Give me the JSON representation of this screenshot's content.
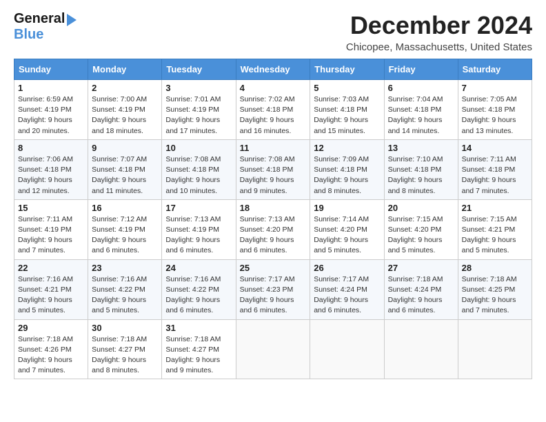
{
  "logo": {
    "line1": "General",
    "line2": "Blue"
  },
  "title": {
    "month_year": "December 2024",
    "location": "Chicopee, Massachusetts, United States"
  },
  "days_of_week": [
    "Sunday",
    "Monday",
    "Tuesday",
    "Wednesday",
    "Thursday",
    "Friday",
    "Saturday"
  ],
  "weeks": [
    [
      {
        "day": "1",
        "sunrise": "Sunrise: 6:59 AM",
        "sunset": "Sunset: 4:19 PM",
        "daylight": "Daylight: 9 hours and 20 minutes."
      },
      {
        "day": "2",
        "sunrise": "Sunrise: 7:00 AM",
        "sunset": "Sunset: 4:19 PM",
        "daylight": "Daylight: 9 hours and 18 minutes."
      },
      {
        "day": "3",
        "sunrise": "Sunrise: 7:01 AM",
        "sunset": "Sunset: 4:19 PM",
        "daylight": "Daylight: 9 hours and 17 minutes."
      },
      {
        "day": "4",
        "sunrise": "Sunrise: 7:02 AM",
        "sunset": "Sunset: 4:18 PM",
        "daylight": "Daylight: 9 hours and 16 minutes."
      },
      {
        "day": "5",
        "sunrise": "Sunrise: 7:03 AM",
        "sunset": "Sunset: 4:18 PM",
        "daylight": "Daylight: 9 hours and 15 minutes."
      },
      {
        "day": "6",
        "sunrise": "Sunrise: 7:04 AM",
        "sunset": "Sunset: 4:18 PM",
        "daylight": "Daylight: 9 hours and 14 minutes."
      },
      {
        "day": "7",
        "sunrise": "Sunrise: 7:05 AM",
        "sunset": "Sunset: 4:18 PM",
        "daylight": "Daylight: 9 hours and 13 minutes."
      }
    ],
    [
      {
        "day": "8",
        "sunrise": "Sunrise: 7:06 AM",
        "sunset": "Sunset: 4:18 PM",
        "daylight": "Daylight: 9 hours and 12 minutes."
      },
      {
        "day": "9",
        "sunrise": "Sunrise: 7:07 AM",
        "sunset": "Sunset: 4:18 PM",
        "daylight": "Daylight: 9 hours and 11 minutes."
      },
      {
        "day": "10",
        "sunrise": "Sunrise: 7:08 AM",
        "sunset": "Sunset: 4:18 PM",
        "daylight": "Daylight: 9 hours and 10 minutes."
      },
      {
        "day": "11",
        "sunrise": "Sunrise: 7:08 AM",
        "sunset": "Sunset: 4:18 PM",
        "daylight": "Daylight: 9 hours and 9 minutes."
      },
      {
        "day": "12",
        "sunrise": "Sunrise: 7:09 AM",
        "sunset": "Sunset: 4:18 PM",
        "daylight": "Daylight: 9 hours and 8 minutes."
      },
      {
        "day": "13",
        "sunrise": "Sunrise: 7:10 AM",
        "sunset": "Sunset: 4:18 PM",
        "daylight": "Daylight: 9 hours and 8 minutes."
      },
      {
        "day": "14",
        "sunrise": "Sunrise: 7:11 AM",
        "sunset": "Sunset: 4:18 PM",
        "daylight": "Daylight: 9 hours and 7 minutes."
      }
    ],
    [
      {
        "day": "15",
        "sunrise": "Sunrise: 7:11 AM",
        "sunset": "Sunset: 4:19 PM",
        "daylight": "Daylight: 9 hours and 7 minutes."
      },
      {
        "day": "16",
        "sunrise": "Sunrise: 7:12 AM",
        "sunset": "Sunset: 4:19 PM",
        "daylight": "Daylight: 9 hours and 6 minutes."
      },
      {
        "day": "17",
        "sunrise": "Sunrise: 7:13 AM",
        "sunset": "Sunset: 4:19 PM",
        "daylight": "Daylight: 9 hours and 6 minutes."
      },
      {
        "day": "18",
        "sunrise": "Sunrise: 7:13 AM",
        "sunset": "Sunset: 4:20 PM",
        "daylight": "Daylight: 9 hours and 6 minutes."
      },
      {
        "day": "19",
        "sunrise": "Sunrise: 7:14 AM",
        "sunset": "Sunset: 4:20 PM",
        "daylight": "Daylight: 9 hours and 5 minutes."
      },
      {
        "day": "20",
        "sunrise": "Sunrise: 7:15 AM",
        "sunset": "Sunset: 4:20 PM",
        "daylight": "Daylight: 9 hours and 5 minutes."
      },
      {
        "day": "21",
        "sunrise": "Sunrise: 7:15 AM",
        "sunset": "Sunset: 4:21 PM",
        "daylight": "Daylight: 9 hours and 5 minutes."
      }
    ],
    [
      {
        "day": "22",
        "sunrise": "Sunrise: 7:16 AM",
        "sunset": "Sunset: 4:21 PM",
        "daylight": "Daylight: 9 hours and 5 minutes."
      },
      {
        "day": "23",
        "sunrise": "Sunrise: 7:16 AM",
        "sunset": "Sunset: 4:22 PM",
        "daylight": "Daylight: 9 hours and 5 minutes."
      },
      {
        "day": "24",
        "sunrise": "Sunrise: 7:16 AM",
        "sunset": "Sunset: 4:22 PM",
        "daylight": "Daylight: 9 hours and 6 minutes."
      },
      {
        "day": "25",
        "sunrise": "Sunrise: 7:17 AM",
        "sunset": "Sunset: 4:23 PM",
        "daylight": "Daylight: 9 hours and 6 minutes."
      },
      {
        "day": "26",
        "sunrise": "Sunrise: 7:17 AM",
        "sunset": "Sunset: 4:24 PM",
        "daylight": "Daylight: 9 hours and 6 minutes."
      },
      {
        "day": "27",
        "sunrise": "Sunrise: 7:18 AM",
        "sunset": "Sunset: 4:24 PM",
        "daylight": "Daylight: 9 hours and 6 minutes."
      },
      {
        "day": "28",
        "sunrise": "Sunrise: 7:18 AM",
        "sunset": "Sunset: 4:25 PM",
        "daylight": "Daylight: 9 hours and 7 minutes."
      }
    ],
    [
      {
        "day": "29",
        "sunrise": "Sunrise: 7:18 AM",
        "sunset": "Sunset: 4:26 PM",
        "daylight": "Daylight: 9 hours and 7 minutes."
      },
      {
        "day": "30",
        "sunrise": "Sunrise: 7:18 AM",
        "sunset": "Sunset: 4:27 PM",
        "daylight": "Daylight: 9 hours and 8 minutes."
      },
      {
        "day": "31",
        "sunrise": "Sunrise: 7:18 AM",
        "sunset": "Sunset: 4:27 PM",
        "daylight": "Daylight: 9 hours and 9 minutes."
      },
      null,
      null,
      null,
      null
    ]
  ]
}
